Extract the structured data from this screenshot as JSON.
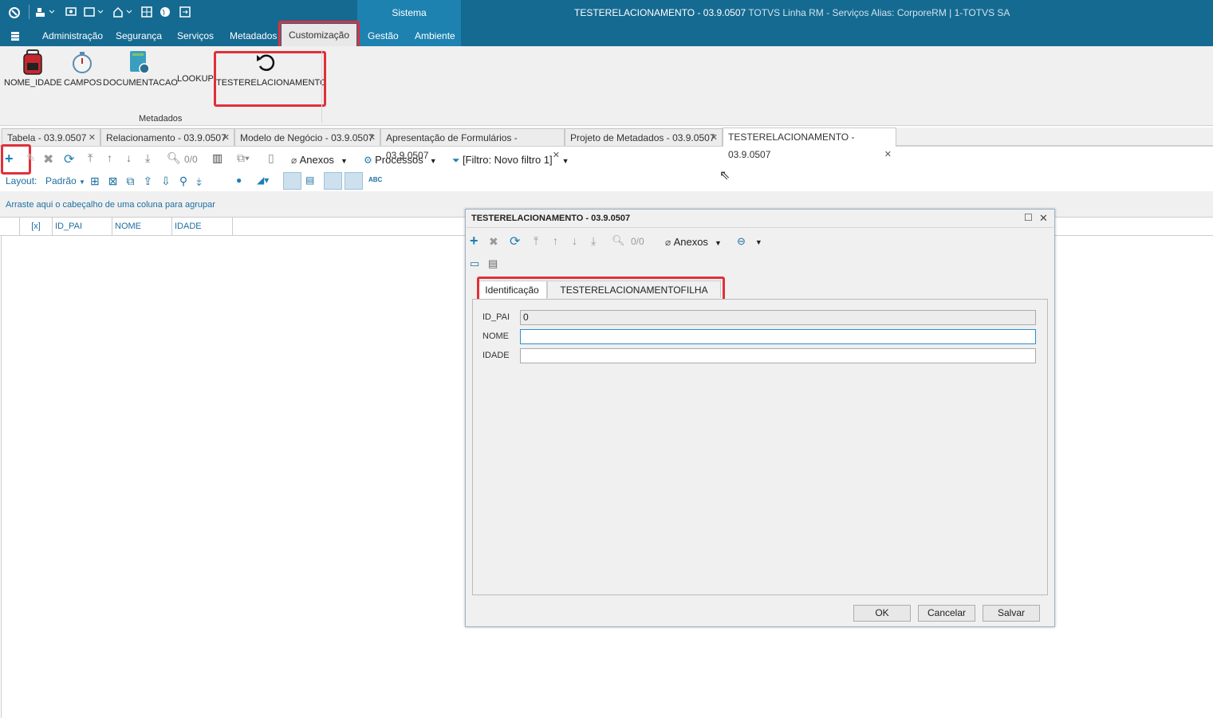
{
  "window": {
    "title": "TESTERELACIONAMENTO - 03.9.0507",
    "app_info": "TOTVS Linha RM - Serviços  Alias: CorporeRM | 1-TOTVS SA",
    "system_tab": "Sistema"
  },
  "ribbon": {
    "tabs": [
      "Administração",
      "Segurança",
      "Serviços",
      "Metadados",
      "Customização",
      "Gestão",
      "Ambiente"
    ],
    "buttons": [
      "NOME_IDADE",
      "CAMPOS",
      "DOCUMENTACAO",
      "LOOKUP",
      "TESTERELACIONAMENTO"
    ],
    "group_label": "Metadados"
  },
  "doc_tabs": [
    "Tabela - 03.9.0507",
    "Relacionamento - 03.9.0507",
    "Modelo de Negócio - 03.9.0507",
    "Apresentação de Formulários - 03.9.0507",
    "Projeto de Metadados - 03.9.0507",
    "TESTERELACIONAMENTO - 03.9.0507"
  ],
  "toolbar": {
    "counter": "0/0",
    "anexos": "Anexos",
    "processos": "Processos",
    "filter": "[Filtro: Novo filtro 1]"
  },
  "layout_bar": {
    "label": "Layout:",
    "value": "Padrão"
  },
  "grid": {
    "group_hint": "Arraste aqui o cabeçalho de uma coluna para agrupar",
    "columns": [
      "[x]",
      "ID_PAI",
      "NOME",
      "IDADE"
    ]
  },
  "dialog": {
    "title": "TESTERELACIONAMENTO - 03.9.0507",
    "counter": "0/0",
    "anexos": "Anexos",
    "tabs": [
      "Identificação",
      "TESTERELACIONAMENTOFILHA"
    ],
    "fields": [
      {
        "label": "ID_PAI",
        "value": "0"
      },
      {
        "label": "NOME",
        "value": ""
      },
      {
        "label": "IDADE",
        "value": ""
      }
    ],
    "buttons": {
      "ok": "OK",
      "cancel": "Cancelar",
      "save": "Salvar"
    }
  }
}
